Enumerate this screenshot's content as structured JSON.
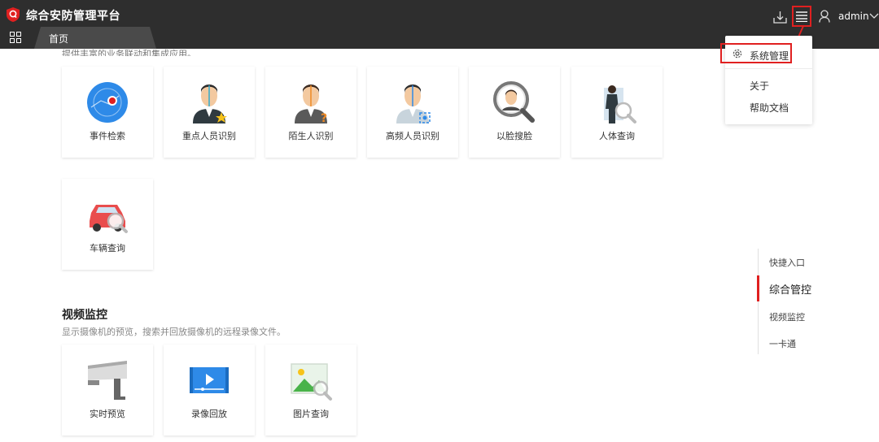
{
  "app": {
    "title": "综合安防管理平台"
  },
  "tabs": [
    {
      "label": "首页"
    }
  ],
  "header": {
    "user": "admin"
  },
  "dropdown": {
    "items": [
      {
        "label": "系统管理"
      },
      {
        "label": "关于"
      },
      {
        "label": "帮助文档"
      }
    ]
  },
  "sections": {
    "top": {
      "desc": "提供丰富的业务联动和集成应用。"
    },
    "video": {
      "title": "视频监控",
      "desc": "显示摄像机的预览，搜索并回放摄像机的远程录像文件。"
    }
  },
  "cards": {
    "event_search": "事件检索",
    "key_person": "重点人员识别",
    "stranger": "陌生人识别",
    "frequent": "高频人员识别",
    "face_search": "以脸搜脸",
    "body_query": "人体查询",
    "vehicle_query": "车辆查询",
    "live_preview": "实时预览",
    "playback": "录像回放",
    "image_query": "图片查询"
  },
  "anchors": [
    {
      "label": "快捷入口"
    },
    {
      "label": "综合管控"
    },
    {
      "label": "视频监控"
    },
    {
      "label": "一卡通"
    }
  ],
  "colors": {
    "accent": "#e02020",
    "topbar": "#2e2e2e",
    "tab": "#4a4a4a"
  }
}
